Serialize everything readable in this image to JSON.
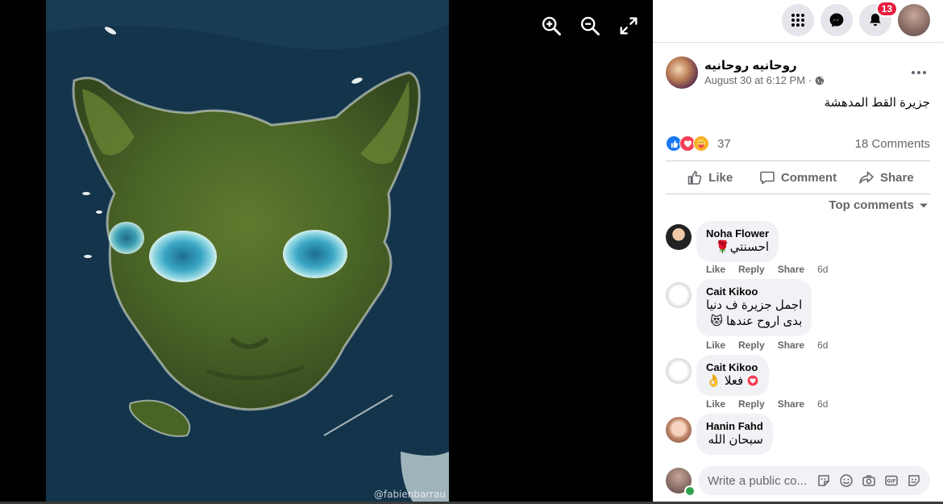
{
  "colors": {
    "accent": "#1877f2",
    "badge": "#e41e3f",
    "muted": "#65676b",
    "bubble": "#f0f2f5",
    "online": "#31a24c"
  },
  "viewer": {
    "photo_credit": "@fabienbarrau",
    "controls": [
      "zoom-in-icon",
      "zoom-out-icon",
      "fullscreen-icon"
    ]
  },
  "topbar": {
    "icons": [
      "menu-grid-icon",
      "messenger-icon",
      "bell-icon"
    ],
    "notification_count": "13"
  },
  "post": {
    "author": "روحانيه روحانيه",
    "timestamp": "August 30 at 6:12 PM",
    "audience_icon": "globe-icon",
    "text": "جزيرة القط المدهشة",
    "reaction_icons": [
      "like-icon",
      "love-icon",
      "care-icon"
    ],
    "reaction_count": "37",
    "comment_count": "18 Comments"
  },
  "actions": {
    "like": "Like",
    "comment": "Comment",
    "share": "Share"
  },
  "comments_filter": "Top comments",
  "comment_action_labels": {
    "like": "Like",
    "reply": "Reply",
    "share": "Share"
  },
  "comments": [
    {
      "name": "Noha Flower",
      "line1": "احسنتي🌹",
      "line2": "",
      "time": "6d"
    },
    {
      "name": "Cait Kikoo",
      "line1": "اجمل جزيرة ف دنيا",
      "line2": "بدى اروح عندها 😻",
      "time": "6d"
    },
    {
      "name": "Cait Kikoo",
      "line1": "فعلا 👌",
      "line2": "",
      "time": "6d"
    },
    {
      "name": "Hanin Fahd",
      "line1": "سبحان الله",
      "line2": "",
      "time": ""
    }
  ],
  "composer": {
    "placeholder": "Write a public co...",
    "icons": [
      "sticker-icon",
      "emoji-icon",
      "camera-icon",
      "gif-icon",
      "avatar-sticker-icon"
    ]
  }
}
